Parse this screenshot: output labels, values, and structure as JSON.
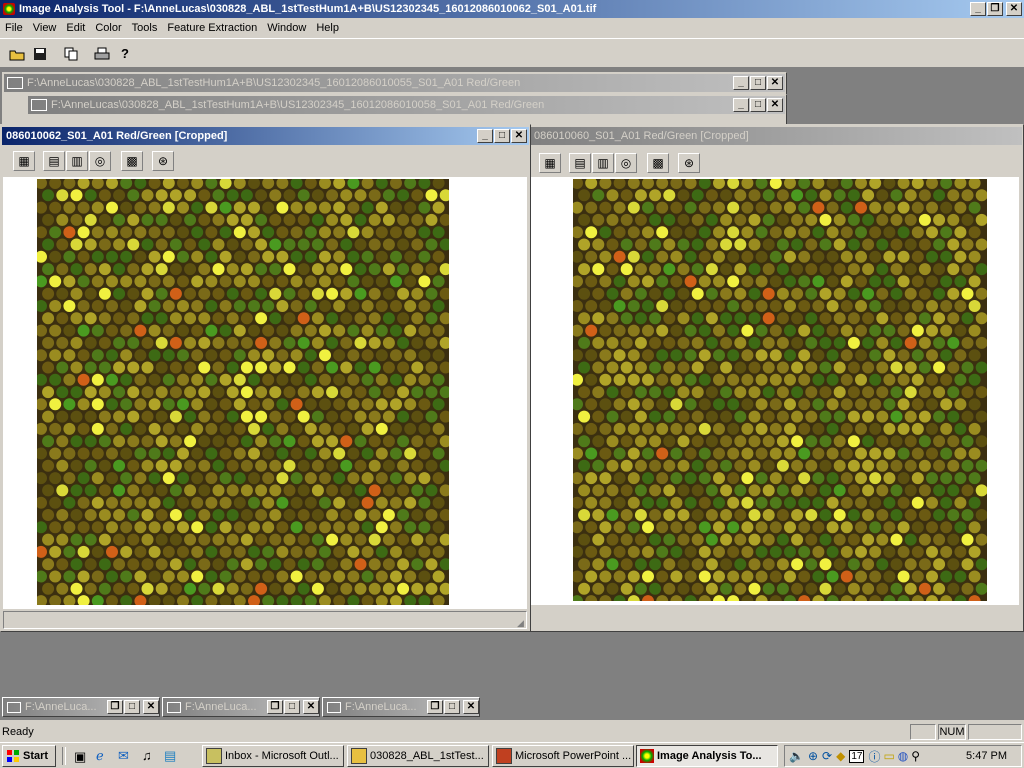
{
  "app": {
    "title": "Image Analysis Tool - F:\\AnneLucas\\030828_ABL_1stTestHum1A+B\\US12302345_16012086010062_S01_A01.tif",
    "menu": [
      "File",
      "View",
      "Edit",
      "Color",
      "Tools",
      "Feature Extraction",
      "Window",
      "Help"
    ]
  },
  "toolbar": {
    "icons": [
      "open-folder-icon",
      "save-disk-icon",
      "copy-icon",
      "print-icon",
      "help-icon"
    ]
  },
  "mdi": {
    "back_windows": [
      "F:\\AnneLucas\\030828_ABL_1stTestHum1A+B\\US12302345_16012086010055_S01_A01 Red/Green",
      "F:\\AnneLucas\\030828_ABL_1stTestHum1A+B\\US12302345_16012086010058_S01_A01 Red/Green"
    ],
    "left_window_title": "086010062_S01_A01 Red/Green [Cropped]",
    "right_window_title": "086010060_S01_A01 Red/Green [Cropped]",
    "minimized": [
      "F:\\AnneLuca...",
      "F:\\AnneLuca...",
      "F:\\AnneLuca..."
    ]
  },
  "status": {
    "text": "Ready",
    "num": "NUM"
  },
  "taskbar": {
    "start": "Start",
    "tasks": [
      "Inbox - Microsoft Outl...",
      "030828_ABL_1stTest...",
      "Microsoft PowerPoint ...",
      "Image Analysis To..."
    ],
    "clock": "5:47 PM",
    "tray_number": "17"
  },
  "colors": {
    "active_title": "#0a246a",
    "desktop": "#808080",
    "array_bg": "#3b2f10"
  }
}
